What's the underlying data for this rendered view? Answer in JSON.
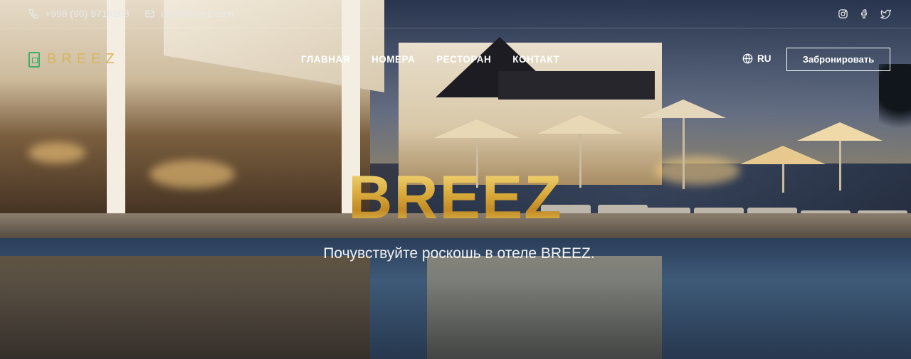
{
  "topbar": {
    "phone": "+998 (90) 9716208",
    "email": "info@breez.com",
    "social": [
      {
        "icon": "instagram-icon"
      },
      {
        "icon": "facebook-icon"
      },
      {
        "icon": "twitter-icon"
      }
    ]
  },
  "header": {
    "logo_text": "BREEZ",
    "nav": [
      "ГЛАВНАЯ",
      "НОМЕРА",
      "РЕСТОРАН",
      "КОНТАКТ"
    ],
    "language": "RU",
    "book_label": "Забронировать"
  },
  "hero": {
    "title": "BREEZ",
    "subtitle": "Почувствуйте роскошь в отеле BREEZ."
  },
  "colors": {
    "brand_gold": "#d7b65e",
    "logo_green": "#3fae6b"
  }
}
